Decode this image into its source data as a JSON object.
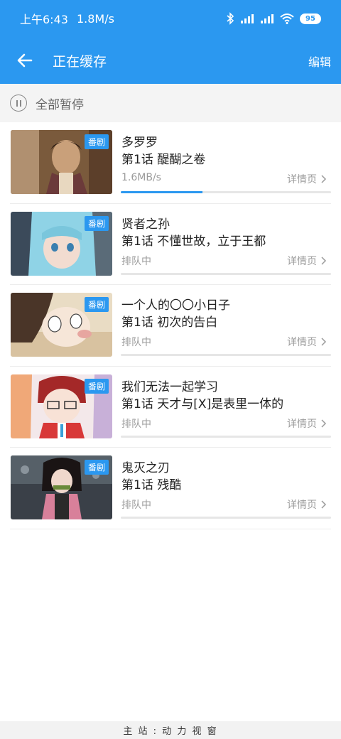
{
  "status_bar": {
    "time": "上午6:43",
    "speed": "1.8M/s",
    "battery": "95"
  },
  "app_bar": {
    "title": "正在缓存",
    "edit_label": "编辑"
  },
  "toolbar": {
    "pause_all_label": "全部暂停"
  },
  "items": [
    {
      "badge": "番剧",
      "title": "多罗罗",
      "episode": "第1话 醍醐之卷",
      "status": "1.6MB/s",
      "detail_label": "详情页",
      "progress": 0.39
    },
    {
      "badge": "番剧",
      "title": "贤者之孙",
      "episode": "第1话 不懂世故，立于王都",
      "status": "排队中",
      "detail_label": "详情页",
      "progress": 0
    },
    {
      "badge": "番剧",
      "title": "一个人的〇〇小日子",
      "episode": "第1话 初次的告白",
      "status": "排队中",
      "detail_label": "详情页",
      "progress": 0
    },
    {
      "badge": "番剧",
      "title": "我们无法一起学习",
      "episode": "第1话 天才与[X]是表里一体的",
      "status": "排队中",
      "detail_label": "详情页",
      "progress": 0
    },
    {
      "badge": "番剧",
      "title": "鬼灭之刃",
      "episode": "第1话 残酷",
      "status": "排队中",
      "detail_label": "详情页",
      "progress": 0
    }
  ],
  "bottom_strip": {
    "text": "主 站 : 动 力 视 窗"
  },
  "colors": {
    "accent": "#2b98f0",
    "track": "#e6e6e6",
    "muted_text": "#9b9b9b"
  },
  "icons": [
    "back-arrow-icon",
    "bluetooth-icon",
    "signal-icon",
    "wifi-icon",
    "battery-icon",
    "pause-icon",
    "chevron-right-icon"
  ]
}
